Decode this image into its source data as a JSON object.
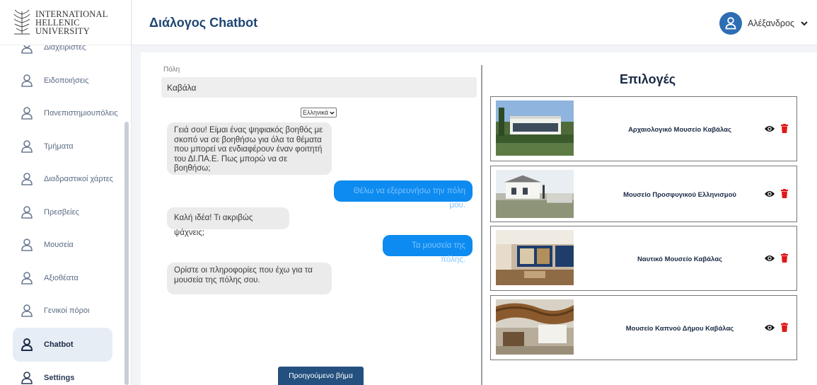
{
  "logo": {
    "line1": "INTERNATIONAL",
    "line2": "HELLENIC",
    "line3": "UNIVERSITY"
  },
  "header": {
    "title": "Διάλογος Chatbot",
    "user_name": "Αλέξανδρος"
  },
  "sidebar": {
    "items": [
      {
        "label": "Διαχειριστές"
      },
      {
        "label": "Ειδοποιήσεις"
      },
      {
        "label": "Πανεπιστημιουπόλεις"
      },
      {
        "label": "Τμήματα"
      },
      {
        "label": "Διαδραστικοί χάρτες"
      },
      {
        "label": "Πρεσβείες"
      },
      {
        "label": "Μουσεία"
      },
      {
        "label": "Αξιοθέατα"
      },
      {
        "label": "Γενικοί πόροι"
      },
      {
        "label": "Chatbot",
        "active": true
      },
      {
        "label": "Settings"
      }
    ]
  },
  "chat": {
    "city_label": "Πόλη",
    "city_value": "Καβάλα",
    "language": "Ελληνικά",
    "messages": [
      {
        "from": "bot",
        "text": "Γειά σου! Είμαι ένας ψηφιακός βοηθός με σκοπό να σε βοηθήσω για όλα τα θέματα που μπορεί να ενδιαφέρουν έναν φοιτητή του ΔΙ.ΠΑ.Ε. Πως μπορώ να σε βοηθήσω;"
      },
      {
        "from": "user",
        "text": "Θέλω να εξερευνήσω την πόλη μου."
      },
      {
        "from": "bot",
        "text": "Καλή ιδέα! Τι ακριβώς ψάχνεις;"
      },
      {
        "from": "user",
        "text": "Τα μουσεία της πόλης."
      },
      {
        "from": "bot",
        "text": "Ορίστε οι πληροφορίες που έχω για τα μουσεία της πόλης σου."
      }
    ],
    "prev_button": "Προηγούμενο βήμα"
  },
  "options": {
    "title": "Επιλογές",
    "items": [
      {
        "title": "Αρχαιολογικό Μουσείο Καβάλας"
      },
      {
        "title": "Μουσείο Προσφυγικού Ελληνισμού"
      },
      {
        "title": "Ναυτικό Μουσείο Καβάλας"
      },
      {
        "title": "Μουσείο Καπνού Δήμου Καβάλας"
      }
    ]
  },
  "colors": {
    "brand": "#1e4673",
    "accent": "#0d8bf0",
    "button": "#24507f",
    "delete": "#e01818"
  },
  "icons": [
    "user-icon",
    "eye-icon",
    "trash-icon",
    "chevron-down-icon",
    "logo-icon"
  ]
}
